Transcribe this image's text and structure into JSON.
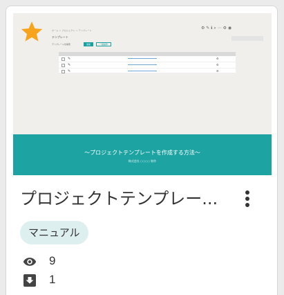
{
  "card": {
    "title": "プロジェクトテンプレー...",
    "tag": "マニュアル",
    "views": "9",
    "downloads": "1",
    "favorite_color": "#f7a31b",
    "accent": "#1ea3a3"
  },
  "thumbnail": {
    "banner_title": "～プロジェクトテンプレートを作成する方法～",
    "banner_subtitle": "株式会社 ○○○○ 制作",
    "nav_text": "ホーム > プロジェクト > テンプレート",
    "page_title": "テンプレート",
    "filter_label": "テンプレートを検索",
    "add_button": "追加",
    "secondary_button": "一括操作",
    "row_count": 3
  },
  "icons": {
    "favorite": "star-icon",
    "menu": "more-vertical-icon",
    "views": "eye-icon",
    "downloads": "download-box-icon"
  }
}
